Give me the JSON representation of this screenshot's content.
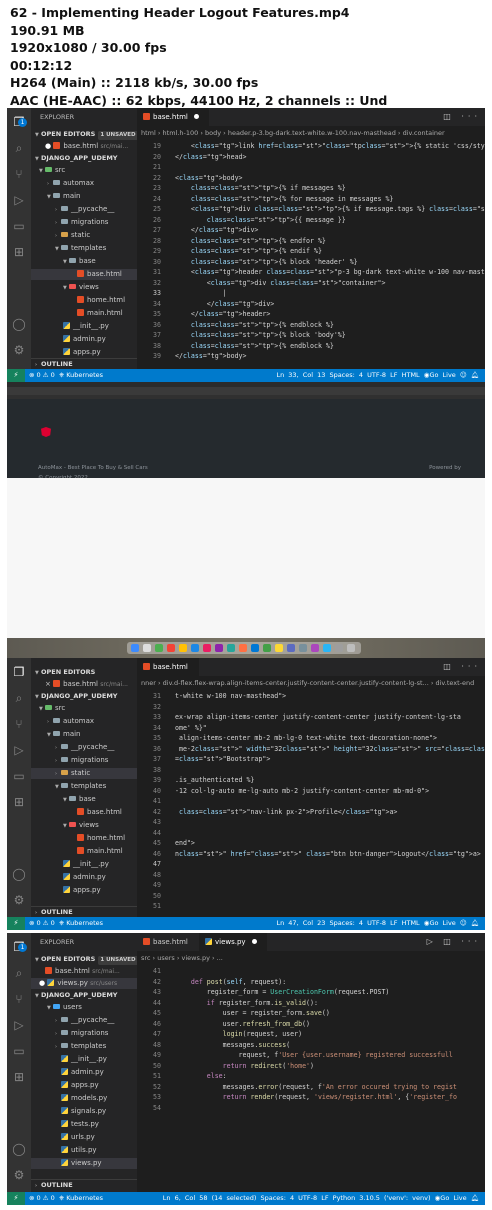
{
  "info": {
    "title": "62 - Implementing Header Logout Features.mp4",
    "size": "190.91 MB",
    "resolution": "1920x1080 / 30.00 fps",
    "duration": "00:12:12",
    "video": "H264 (Main) :: 2118 kb/s, 30.00 fps",
    "audio": "AAC (HE-AAC) :: 62 kbps, 44100 Hz, 2 channels :: Und"
  },
  "frame1": {
    "sidebar": {
      "title": "EXPLORER",
      "open_editors": "OPEN EDITORS",
      "unsaved": "1 UNSAVED",
      "open_file": "base.html",
      "open_file_path": "src/mai...",
      "project": "DJANGO_APP_UDEMY",
      "tree": [
        "src",
        "automax",
        "main",
        "__pycache__",
        "migrations",
        "static",
        "templates",
        "base",
        "base.html",
        "views",
        "home.html",
        "main.html",
        "__init__.py",
        "admin.py",
        "apps.py"
      ],
      "outline": "OUTLINE"
    },
    "tab": "base.html",
    "breadcrumb": "html › html.h-100 › body › header.p-3.bg-dark.text-white.w-100.nav-masthead › div.container",
    "lines": [
      {
        "n": "19",
        "t": "    <link href=\"{% static 'css/style.css' %}\" rel=\"stylesheet\">"
      },
      {
        "n": "20",
        "t": "</head>"
      },
      {
        "n": "21",
        "t": ""
      },
      {
        "n": "22",
        "t": "<body>"
      },
      {
        "n": "23",
        "t": "    {% if messages %}"
      },
      {
        "n": "24",
        "t": "    {% for message in messages %}"
      },
      {
        "n": "25",
        "t": "    <div {% if message.tags %} class=\"alert alert-{{ message.tags }}\" {"
      },
      {
        "n": "26",
        "t": "        {{ message }}"
      },
      {
        "n": "27",
        "t": "    </div>"
      },
      {
        "n": "28",
        "t": "    {% endfor %}"
      },
      {
        "n": "29",
        "t": "    {% endif %}"
      },
      {
        "n": "30",
        "t": "    {% block 'header' %}"
      },
      {
        "n": "31",
        "t": "    <header class=\"p-3 bg-dark text-white w-100 nav-masthead\">"
      },
      {
        "n": "32",
        "t": "        <div class=\"container\">"
      },
      {
        "n": "33",
        "t": "            |"
      },
      {
        "n": "34",
        "t": "        </div>"
      },
      {
        "n": "35",
        "t": "    </header>"
      },
      {
        "n": "36",
        "t": "    {% endblock %}"
      },
      {
        "n": "37",
        "t": "    {% block 'body'%}"
      },
      {
        "n": "38",
        "t": "    {% endblock %}"
      },
      {
        "n": "39",
        "t": "</body>"
      }
    ],
    "status": {
      "errors": "0",
      "warnings": "0",
      "k8s": "Kubernetes",
      "pos": "Ln 33, Col 13",
      "spaces": "Spaces: 4",
      "enc": "UTF-8",
      "eol": "LF",
      "lang": "HTML",
      "live": "Go Live"
    }
  },
  "frame2": {
    "footer_left": "AutoMax - Best Place To Buy & Sell Cars",
    "copyright": "© Copyright 2022",
    "powered": "Powered by"
  },
  "frame3": {
    "sidebar": {
      "open_editors": "OPEN EDITORS",
      "open_file": "base.html",
      "open_file_path": "src/mai...",
      "project": "DJANGO_APP_UDEMY",
      "tree": [
        "src",
        "automax",
        "main",
        "__pycache__",
        "migrations",
        "static",
        "templates",
        "base",
        "base.html",
        "views",
        "home.html",
        "main.html",
        "__init__.py",
        "admin.py",
        "apps.py"
      ],
      "outline": "OUTLINE"
    },
    "tab": "base.html",
    "breadcrumb": "nner › div.d-flex.flex-wrap.align-items-center.justify-content-center.justify-content-lg-st... › div.text-end",
    "lines": [
      {
        "n": "31",
        "t": "t-white w-100 nav-masthead\">"
      },
      {
        "n": "32",
        "t": ""
      },
      {
        "n": "33",
        "t": "ex-wrap align-items-center justify-content-center justify-content-lg-sta"
      },
      {
        "n": "34",
        "t": "ome' %}\""
      },
      {
        "n": "35",
        "t": " align-items-center mb-2 mb-lg-0 text-white text-decoration-none\">"
      },
      {
        "n": "36",
        "t": " me-2\" width=\"32\" height=\"32\" src=\"{% static 'images/logo.png' %}\""
      },
      {
        "n": "37",
        "t": "=\"Bootstrap\">"
      },
      {
        "n": "38",
        "t": ""
      },
      {
        "n": "39",
        "t": ".is_authenticated %}"
      },
      {
        "n": "40",
        "t": "-12 col-lg-auto me-lg-auto mb-2 justify-content-center mb-md-0\">"
      },
      {
        "n": "41",
        "t": ""
      },
      {
        "n": "42",
        "t": " class=\"nav-link px-2\">Profile</a>"
      },
      {
        "n": "43",
        "t": ""
      },
      {
        "n": "44",
        "t": ""
      },
      {
        "n": "45",
        "t": "end\">"
      },
      {
        "n": "46",
        "t": "n\" href=\"\" class=\"btn btn-danger\">Logout</a>"
      },
      {
        "n": "47",
        "t": ""
      },
      {
        "n": "48",
        "t": ""
      },
      {
        "n": "49",
        "t": ""
      },
      {
        "n": "50",
        "t": ""
      },
      {
        "n": "51",
        "t": ""
      }
    ],
    "status": {
      "errors": "0",
      "warnings": "0",
      "k8s": "Kubernetes",
      "pos": "Ln 47, Col 23",
      "spaces": "Spaces: 4",
      "enc": "UTF-8",
      "eol": "LF",
      "lang": "HTML",
      "live": "Go Live"
    }
  },
  "frame4": {
    "sidebar": {
      "title": "EXPLORER",
      "open_editors": "OPEN EDITORS",
      "unsaved": "1 UNSAVED",
      "open_file_1": "base.html",
      "open_file_1_path": "src/mai...",
      "open_file_2": "views.py",
      "open_file_2_path": "src/users",
      "project": "DJANGO_APP_UDEMY",
      "tree": [
        "users",
        "__pycache__",
        "migrations",
        "templates",
        "__init__.py",
        "admin.py",
        "apps.py",
        "models.py",
        "signals.py",
        "tests.py",
        "urls.py",
        "utils.py",
        "views.py"
      ],
      "outline": "OUTLINE"
    },
    "tab1": "base.html",
    "tab2": "views.py",
    "breadcrumb": "src › users › views.py › ...",
    "lines": [
      {
        "n": "41",
        "t": ""
      },
      {
        "n": "42",
        "t": "    def post(self, request):"
      },
      {
        "n": "43",
        "t": "        register_form = UserCreationForm(request.POST)"
      },
      {
        "n": "44",
        "t": "        if register_form.is_valid():"
      },
      {
        "n": "45",
        "t": "            user = register_form.save()"
      },
      {
        "n": "46",
        "t": "            user.refresh_from_db()"
      },
      {
        "n": "47",
        "t": "            login(request, user)"
      },
      {
        "n": "48",
        "t": "            messages.success("
      },
      {
        "n": "49",
        "t": "                request, f'User {user.username} registered successfull"
      },
      {
        "n": "50",
        "t": "            return redirect('home')"
      },
      {
        "n": "51",
        "t": "        else:"
      },
      {
        "n": "52",
        "t": "            messages.error(request, f'An error occured trying to regist"
      },
      {
        "n": "53",
        "t": "            return render(request, 'views/register.html', {'register_fo"
      },
      {
        "n": "54",
        "t": ""
      }
    ],
    "status": {
      "errors": "0",
      "warnings": "0",
      "k8s": "Kubernetes",
      "pos": "Ln 6, Col 58 (14 selected)",
      "spaces": "Spaces: 4",
      "enc": "UTF-8",
      "eol": "LF",
      "lang": "Python",
      "pyver": "3.10.5 ('venv': venv)",
      "live": "Go Live"
    }
  }
}
